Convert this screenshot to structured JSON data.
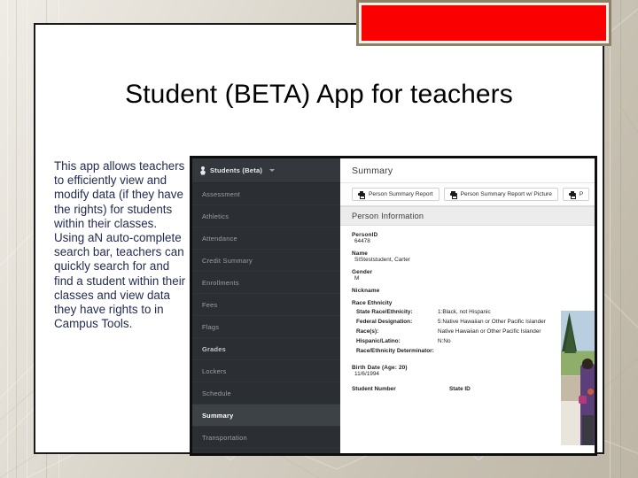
{
  "slide": {
    "title": "Student (BETA) App for teachers",
    "body_text": "This app allows teachers to efficiently view and modify data (if they have the rights) for students within their classes. Using aN auto-complete search bar, teachers can quickly search for and find a student within their classes and view data they have rights to in Campus Tools.",
    "banner_color": "#fa0000",
    "banner_frame_color": "#8d8467"
  },
  "app": {
    "sidebar": {
      "header_label": "Students (Beta)",
      "header_icon": "person-icon",
      "caret_icon": "chevron-down-icon",
      "items": [
        {
          "label": "Assessment",
          "state": "normal"
        },
        {
          "label": "Athletics",
          "state": "normal"
        },
        {
          "label": "Attendance",
          "state": "normal"
        },
        {
          "label": "Credit Summary",
          "state": "normal"
        },
        {
          "label": "Enrollments",
          "state": "normal"
        },
        {
          "label": "Fees",
          "state": "normal"
        },
        {
          "label": "Flags",
          "state": "normal"
        },
        {
          "label": "Grades",
          "state": "semi"
        },
        {
          "label": "Lockers",
          "state": "normal"
        },
        {
          "label": "Schedule",
          "state": "normal"
        },
        {
          "label": "Summary",
          "state": "active"
        },
        {
          "label": "Transportation",
          "state": "normal"
        }
      ]
    },
    "main": {
      "page_title": "Summary",
      "report_buttons": [
        {
          "label": "Person Summary Report",
          "icon": "printer-icon"
        },
        {
          "label": "Person Summary Report w/ Picture",
          "icon": "printer-icon"
        },
        {
          "label": "P",
          "icon": "printer-icon"
        }
      ],
      "section_title": "Person Information",
      "fields": [
        {
          "key": "PersonID",
          "value": "64478"
        },
        {
          "key": "Name",
          "value": "SISteststudent, Carter"
        },
        {
          "key": "Gender",
          "value": "M"
        },
        {
          "key": "Nickname",
          "value": ""
        }
      ],
      "race_ethnicity": {
        "heading": "Race Ethnicity",
        "rows": [
          {
            "key": "State Race/Ethnicity:",
            "value": "1:Black, not Hispanic"
          },
          {
            "key": "Federal Designation:",
            "value": "5:Native Hawaiian or Other Pacific Islander"
          },
          {
            "key": "Race(s):",
            "value": "Native Hawaiian or Other Pacific Islander"
          },
          {
            "key": "Hispanic/Latino:",
            "value": "N:No"
          },
          {
            "key": "Race/Ethnicity Determinator:",
            "value": ""
          }
        ]
      },
      "birth": {
        "key": "Birth Date (Age: 20)",
        "value": "11/6/1994"
      },
      "bottom": {
        "student_number": "Student Number",
        "state_id": "State ID"
      },
      "photo_alt": "student-photo"
    }
  }
}
